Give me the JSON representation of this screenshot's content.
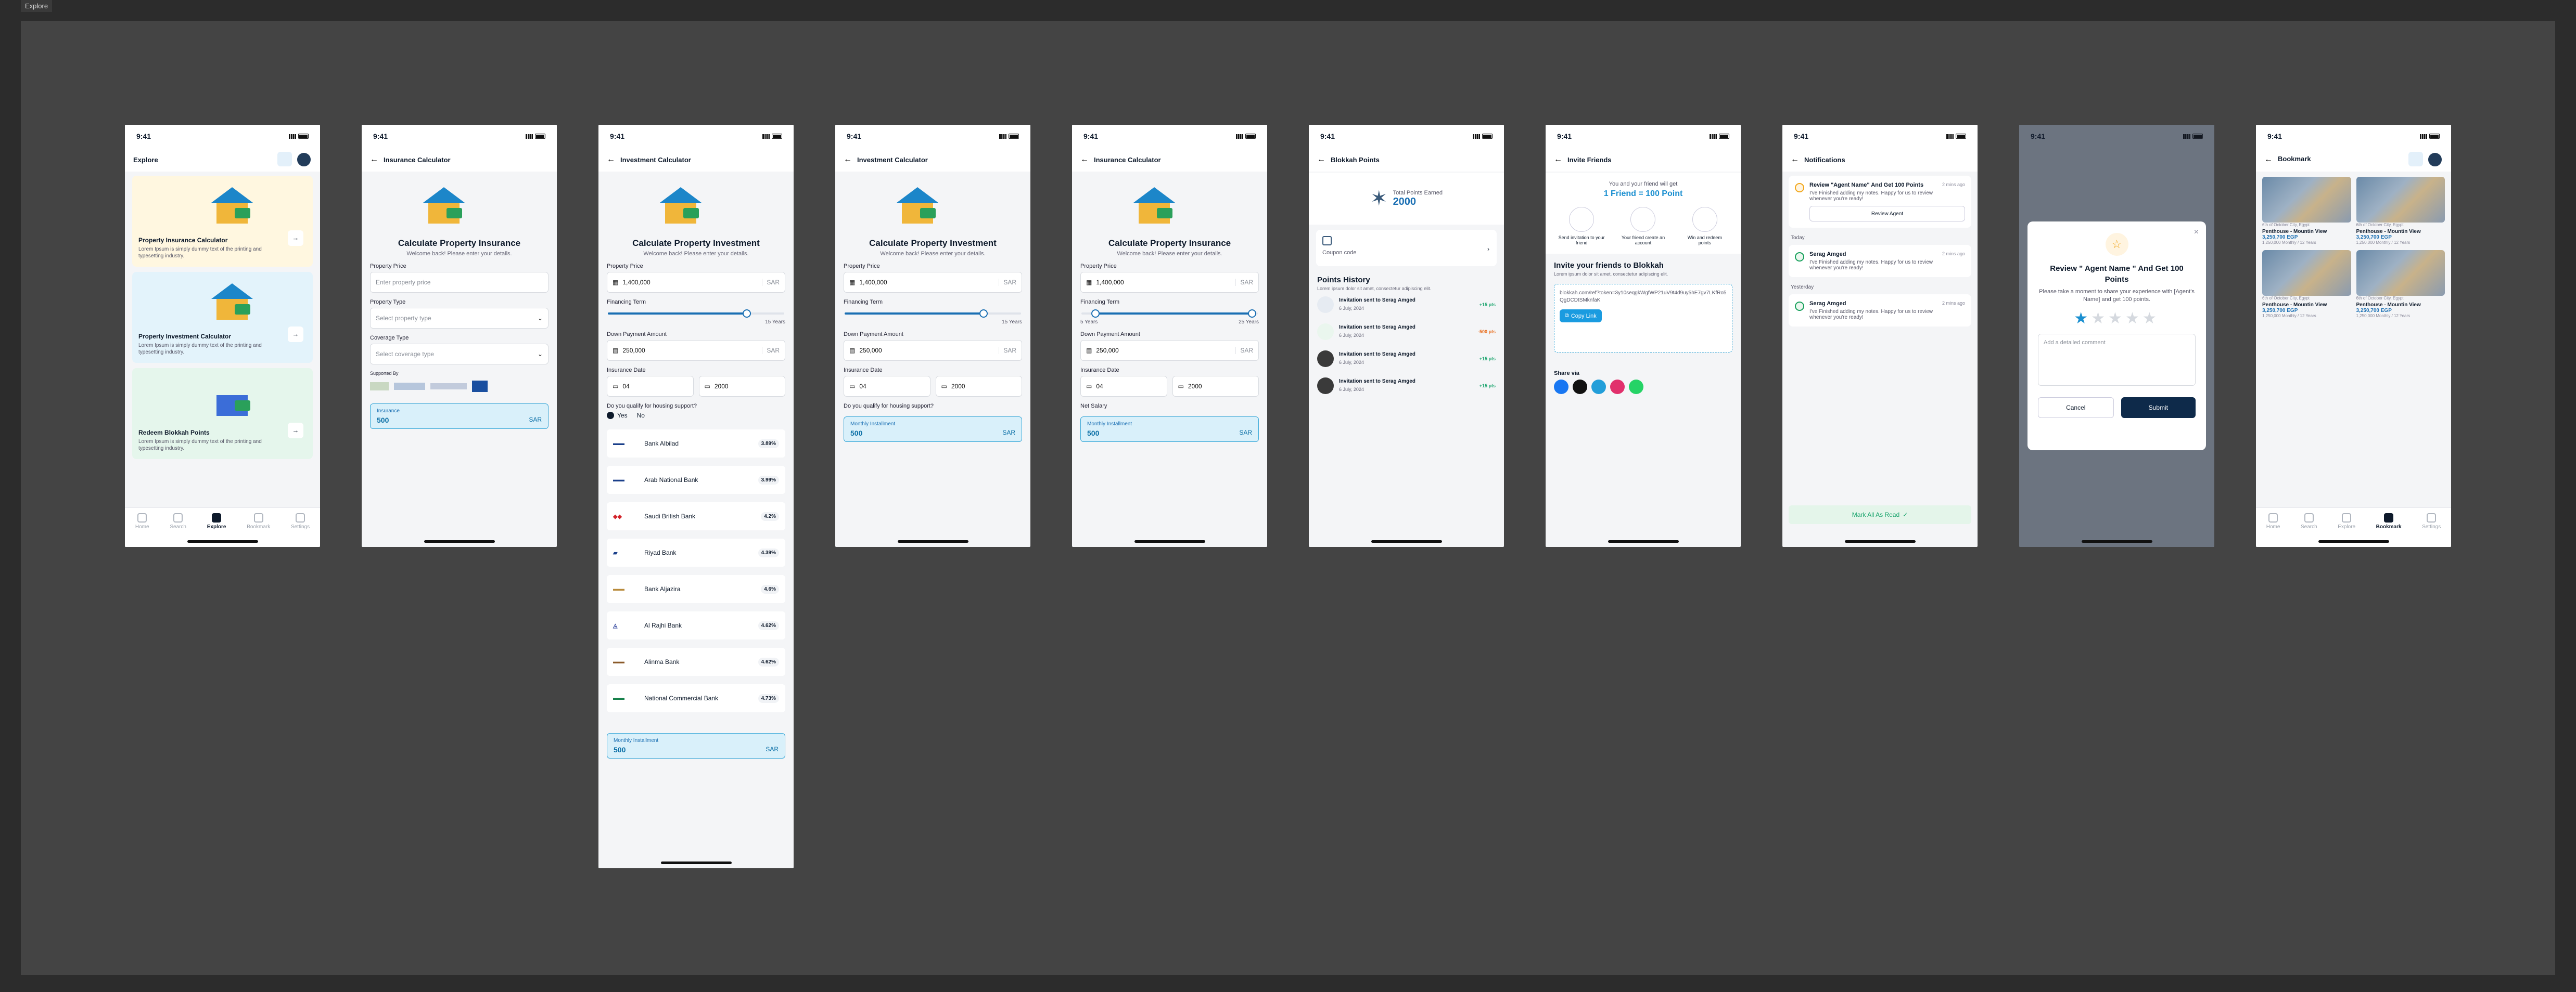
{
  "frame_tag": "Explore",
  "status_time": "9:41",
  "explore": {
    "title": "Explore",
    "cards": [
      {
        "title": "Property Insurance Calculator",
        "desc": "Lorem Ipsum is simply dummy text of the printing and typesetting industry.",
        "bg": "#fff7e0"
      },
      {
        "title": "Property Investment Calculator",
        "desc": "Lorem Ipsum is simply dummy text of the printing and typesetting industry.",
        "bg": "#e3f3fb"
      },
      {
        "title": "Redeem Blokkah Points",
        "desc": "Lorem Ipsum is simply dummy text of the printing and typesetting industry.",
        "bg": "#e5f6ec"
      }
    ],
    "tabs": [
      "Home",
      "Search",
      "Explore",
      "Bookmark",
      "Settings"
    ],
    "active_tab": "Explore"
  },
  "ins1": {
    "header": "Insurance Calculator",
    "title": "Calculate Property Insurance",
    "subtitle": "Welcome back! Please enter your details.",
    "price_label": "Property Price",
    "price_ph": "Enter property price",
    "type_label": "Property Type",
    "type_ph": "Select property type",
    "cov_label": "Coverage Type",
    "cov_ph": "Select coverage type",
    "supported": "Supported By",
    "res_label": "Insurance",
    "res_value": "500",
    "res_unit": "SAR"
  },
  "inv1": {
    "header": "Investment Calculator",
    "title": "Calculate Property Investment",
    "subtitle": "Welcome back! Please enter your details.",
    "price_label": "Property Price",
    "price": "1,400,000",
    "unit": "SAR",
    "term_label": "Financing Term",
    "term_val": "15 Years",
    "down_label": "Down Payment Amount",
    "down": "250,000",
    "date_label": "Insurance Date",
    "day": "04",
    "year": "2000",
    "housing_q": "Do you qualify for housing support?",
    "yes": "Yes",
    "no": "No",
    "banks": [
      {
        "name": "Bank Albilad",
        "rate": "3.89%"
      },
      {
        "name": "Arab National Bank",
        "rate": "3.99%"
      },
      {
        "name": "Saudi British Bank",
        "rate": "4.2%"
      },
      {
        "name": "Riyad Bank",
        "rate": "4.39%"
      },
      {
        "name": "Bank Aljazira",
        "rate": "4.6%"
      },
      {
        "name": "Al Rajhi Bank",
        "rate": "4.62%"
      },
      {
        "name": "Alinma Bank",
        "rate": "4.62%"
      },
      {
        "name": "National Commercial Bank",
        "rate": "4.73%"
      }
    ],
    "res_label": "Monthly Installment",
    "res_value": "500",
    "res_unit": "SAR"
  },
  "inv2": {
    "header": "Investment Calculator",
    "title": "Calculate Property Investment",
    "subtitle": "Welcome back! Please enter your details.",
    "price_label": "Property Price",
    "price": "1,400,000",
    "unit": "SAR",
    "term_label": "Financing Term",
    "term_val": "15 Years",
    "down_label": "Down Payment Amount",
    "down": "250,000",
    "date_label": "Insurance Date",
    "day": "04",
    "year": "2000",
    "housing_q": "Do you qualify for housing support?",
    "res_label": "Monthly Installment",
    "res_value": "500",
    "res_unit": "SAR"
  },
  "ins2": {
    "header": "Insurance Calculator",
    "title": "Calculate Property Insurance",
    "subtitle": "Welcome back! Please enter your details.",
    "price_label": "Property Price",
    "price": "1,400,000",
    "unit": "SAR",
    "term_label": "Financing Term",
    "term_min": "5 Years",
    "term_max": "25 Years",
    "down_label": "Down Payment Amount",
    "down": "250,000",
    "date_label": "Insurance Date",
    "day": "04",
    "year": "2000",
    "salary_label": "Net Salary",
    "res_label": "Monthly Installment",
    "res_value": "500",
    "res_unit": "SAR"
  },
  "points": {
    "header": "Blokkah Points",
    "total_label": "Total Points Earned",
    "total": "2000",
    "coupon": "Coupon code",
    "history_title": "Points History",
    "history_sub": "Lorem ipsum dolor sit amet, consectetur adipiscing elit.",
    "items": [
      {
        "title": "Invitation sent to Serag Amged",
        "date": "6 July, 2024",
        "val": "+15 pts",
        "kind": "green"
      },
      {
        "title": "Invitation sent to Serag Amged",
        "date": "6 July, 2024",
        "val": "-500 pts",
        "kind": "orange"
      },
      {
        "title": "Invitation sent to Serag Amged",
        "date": "6 July, 2024",
        "val": "+15 pts",
        "kind": "green"
      },
      {
        "title": "Invitation sent to Serag Amged",
        "date": "6 July, 2024",
        "val": "+15 pts",
        "kind": "green"
      }
    ]
  },
  "invite": {
    "header": "Invite Friends",
    "promo1": "You and your friend will get",
    "promo2": "1 Friend = 100 Point",
    "steps": [
      "Send invitation to your friend",
      "Your friend create an account",
      "Win and redeem points"
    ],
    "title": "Invite your friends to Blokkah",
    "sub": "Lorem ipsum dolor sit amet, consectetur adipiscing elit.",
    "link": "blokkah.com/ref?token=3y10seqgkWgfWP21uV9t4d9uy5hE7gv7LKfRo5QgDCDtSMknfaK",
    "copy": "Copy Link",
    "share": "Share via"
  },
  "notifs": {
    "header": "Notifications",
    "n1_title": "Review \"Agent Name\" And Get 100 Points",
    "n1_time": "2 mins ago",
    "n1_text": "I've Finished adding my notes. Happy for us to review whenever you're ready!",
    "n1_btn": "Review Agent",
    "today": "Today",
    "yesterday": "Yesterday",
    "n2_title": "Serag Amged",
    "n2_time": "2 mins ago",
    "n2_text": "I've Finished adding my notes. Happy for us to review whenever you're ready!",
    "n3_title": "Serag Amged",
    "n3_time": "2 mins ago",
    "n3_text": "I've Finished adding my notes. Happy for us to review whenever you're ready!",
    "mark": "Mark All As Read"
  },
  "review": {
    "title": "Review \" Agent Name \" And Get 100 Points",
    "sub": "Please take a moment to share your experience with [Agent's Name] and get 100 points.",
    "rating": 1,
    "ph": "Add a detailed comment",
    "cancel": "Cancel",
    "submit": "Submit"
  },
  "bookmark": {
    "header": "Bookmark",
    "items": [
      {
        "tag": "6th of October City, Egypt",
        "name": "Penthouse - Mountin View",
        "price": "3,250,700 EGP",
        "small": "1,250,000 Monthly / 12 Years"
      },
      {
        "tag": "6th of October City, Egypt",
        "name": "Penthouse - Mountin View",
        "price": "3,250,700 EGP",
        "small": "1,250,000 Monthly / 12 Years"
      },
      {
        "tag": "6th of October City, Egypt",
        "name": "Penthouse - Mountin View",
        "price": "3,250,700 EGP",
        "small": "1,250,000 Monthly / 12 Years"
      },
      {
        "tag": "6th of October City, Egypt",
        "name": "Penthouse - Mountin View",
        "price": "3,250,700 EGP",
        "small": "1,250,000 Monthly / 12 Years"
      }
    ],
    "active_tab": "Bookmark"
  }
}
